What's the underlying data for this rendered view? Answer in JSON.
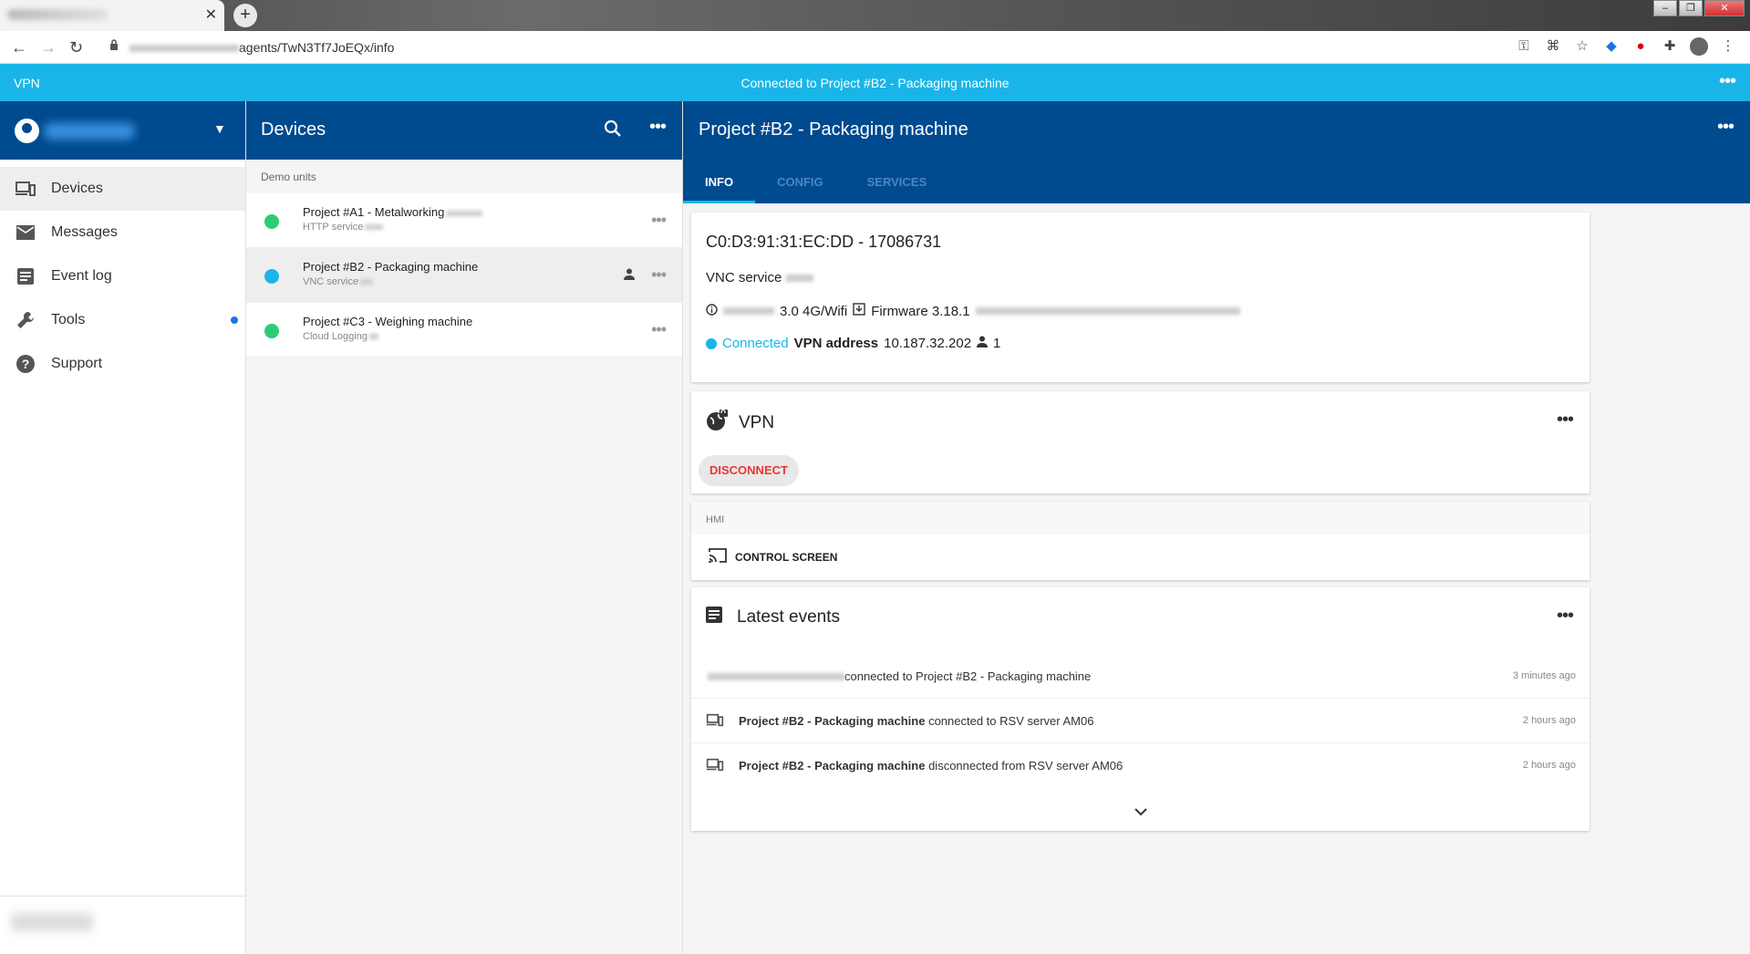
{
  "browser": {
    "url_path": "agents/TwN3Tf7JoEQx/info"
  },
  "vpn_bar": {
    "label": "VPN",
    "status": "Connected to Project #B2 - Packaging machine"
  },
  "sidebar": {
    "items": [
      {
        "label": "Devices",
        "icon": "devices-icon",
        "active": true
      },
      {
        "label": "Messages",
        "icon": "mail-icon"
      },
      {
        "label": "Event log",
        "icon": "event-log-icon"
      },
      {
        "label": "Tools",
        "icon": "wrench-icon",
        "badge": true
      },
      {
        "label": "Support",
        "icon": "help-icon"
      }
    ]
  },
  "devices": {
    "title": "Devices",
    "group": "Demo units",
    "list": [
      {
        "name": "Project #A1 - Metalworking",
        "service": "HTTP service",
        "status_color": "#2ecc71"
      },
      {
        "name": "Project #B2 - Packaging machine",
        "service": "VNC service",
        "status_color": "#1ab5e8",
        "selected": true
      },
      {
        "name": "Project #C3 - Weighing machine",
        "service": "Cloud Logging",
        "status_color": "#2ecc71"
      }
    ]
  },
  "detail": {
    "title": "Project #B2 - Packaging machine",
    "tabs": [
      "INFO",
      "CONFIG",
      "SERVICES"
    ],
    "mac": "C0:D3:91:31:EC:DD - 17086731",
    "service": "VNC service",
    "connection_type": "3.0 4G/Wifi",
    "firmware": "Firmware 3.18.1",
    "connected_label": "Connected",
    "vpn_address_label": "VPN address",
    "vpn_address": "10.187.32.202",
    "users_count": "1",
    "vpn_card": {
      "title": "VPN",
      "disconnect_label": "DISCONNECT"
    },
    "hmi": {
      "label": "HMI",
      "control_label": "CONTROL SCREEN"
    },
    "events": {
      "title": "Latest events",
      "items": [
        {
          "prefix": "",
          "text": "connected to Project #B2 - Packaging machine",
          "time": "3 minutes ago"
        },
        {
          "prefix": "Project #B2 - Packaging machine",
          "text": " connected to RSV server AM06",
          "time": "2 hours ago"
        },
        {
          "prefix": "Project #B2 - Packaging machine",
          "text": " disconnected from RSV server AM06",
          "time": "2 hours ago"
        }
      ]
    }
  },
  "colors": {
    "primary": "#004a8f",
    "accent": "#1ab5e8",
    "danger": "#e53935"
  }
}
